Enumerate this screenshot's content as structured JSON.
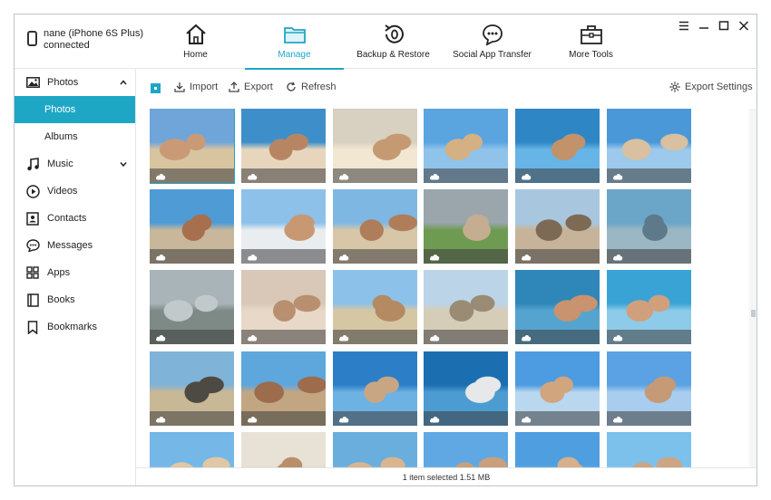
{
  "device": {
    "name": "nane (iPhone 6S Plus)",
    "status": "connected",
    "icon": "phone-icon"
  },
  "nav": [
    {
      "label": "Home",
      "icon": "home-icon"
    },
    {
      "label": "Manage",
      "icon": "folder-icon",
      "active": true
    },
    {
      "label": "Backup & Restore",
      "icon": "backup-restore-icon"
    },
    {
      "label": "Social App Transfer",
      "icon": "chat-bubble-icon"
    },
    {
      "label": "More Tools",
      "icon": "toolbox-icon"
    }
  ],
  "window_controls": [
    "menu-icon",
    "maximize-icon",
    "close-icon"
  ],
  "sidebar": {
    "photos_label": "Photos",
    "photos_sub": [
      "Photos",
      "Albums"
    ],
    "music_label": "Music",
    "items": [
      "Videos",
      "Contacts",
      "Messages",
      "Apps",
      "Books",
      "Bookmarks"
    ]
  },
  "toolbar": {
    "import_label": "Import",
    "export_label": "Export",
    "refresh_label": "Refresh",
    "export_settings_label": "Export Settings"
  },
  "status": {
    "text": "1 item selected 1.51 MB"
  },
  "colors": {
    "accent": "#1ea7c5"
  }
}
